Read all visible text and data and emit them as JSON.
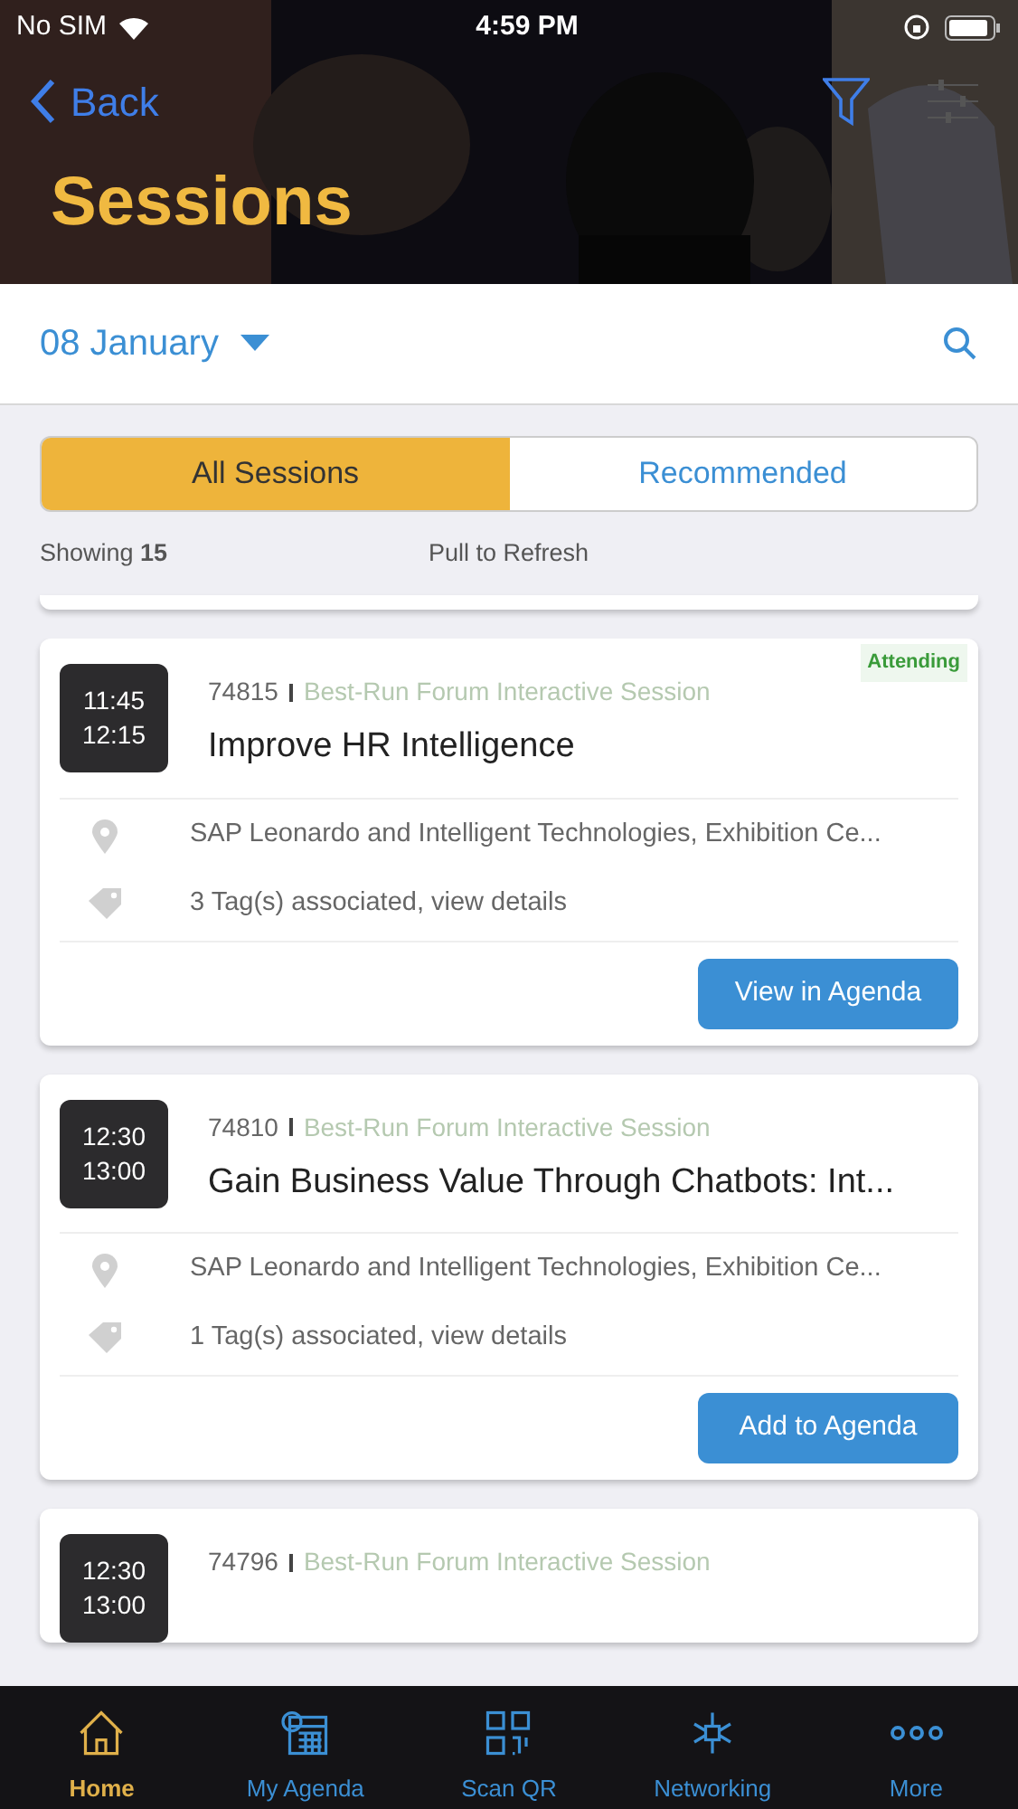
{
  "status_bar": {
    "carrier": "No SIM",
    "time": "4:59 PM"
  },
  "header": {
    "back": "Back",
    "title": "Sessions"
  },
  "date_bar": {
    "date": "08 January"
  },
  "segments": [
    {
      "label": "All Sessions",
      "selected": true
    },
    {
      "label": "Recommended",
      "selected": false
    }
  ],
  "info": {
    "showing": "Showing **15**",
    "refresh": "Pull to Refresh"
  },
  "sessions": [
    {
      "start": "11:45",
      "end": "12:15",
      "id": "74815",
      "category": "Best-Run Forum Interactive Session",
      "badge": "Attending",
      "title": "Improve HR Intelligence",
      "location": "SAP Leonardo and Intelligent Technologies, Exhibition Ce...",
      "tags": "3 Tag(s) associated, view details",
      "action": "View in Agenda"
    },
    {
      "start": "12:30",
      "end": "13:00",
      "id": "74810",
      "category": "Best-Run Forum Interactive Session",
      "title": "Gain Business Value Through Chatbots: Int...",
      "location": "SAP Leonardo and Intelligent Technologies, Exhibition Ce...",
      "tags": "1 Tag(s) associated, view details",
      "action": "Add to Agenda"
    },
    {
      "start": "12:30",
      "end": "13:00",
      "id": "74796",
      "category": "Best-Run Forum Interactive Session"
    }
  ],
  "tab_bar": [
    {
      "label": "Home",
      "selected": true,
      "kind": "home"
    },
    {
      "label": "My Agenda",
      "selected": false,
      "kind": "agenda"
    },
    {
      "label": "Scan QR",
      "selected": false,
      "kind": "qr"
    },
    {
      "label": "Networking",
      "selected": false,
      "kind": "network"
    },
    {
      "label": "More",
      "selected": false,
      "kind": "more"
    }
  ]
}
